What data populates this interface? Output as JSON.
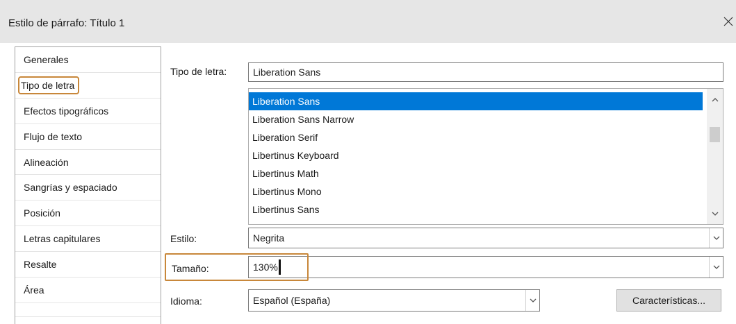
{
  "window": {
    "title": "Estilo de párrafo: Título 1"
  },
  "sidebar": {
    "items": [
      {
        "label": "Generales"
      },
      {
        "label": "Tipo de letra"
      },
      {
        "label": "Efectos tipográficos"
      },
      {
        "label": "Flujo de texto"
      },
      {
        "label": "Alineación"
      },
      {
        "label": "Sangrías y espaciado"
      },
      {
        "label": "Posición"
      },
      {
        "label": "Letras capitulares"
      },
      {
        "label": "Resalte"
      },
      {
        "label": "Área"
      }
    ]
  },
  "font": {
    "label": "Tipo de letra:",
    "value": "Liberation Sans",
    "list": [
      "Liberation Sans",
      "Liberation Sans Narrow",
      "Liberation Serif",
      "Libertinus Keyboard",
      "Libertinus Math",
      "Libertinus Mono",
      "Libertinus Sans"
    ]
  },
  "style": {
    "label": "Estilo:",
    "value": "Negrita"
  },
  "size": {
    "label": "Tamaño:",
    "value": "130%"
  },
  "language": {
    "label": "Idioma:",
    "value": "Español (España)",
    "features_button": "Características..."
  },
  "colors": {
    "selection": "#0078d7",
    "highlight": "#c8873a"
  }
}
